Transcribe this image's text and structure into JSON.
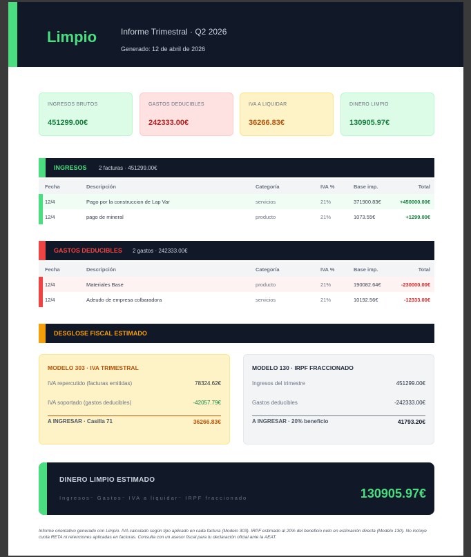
{
  "header": {
    "brand": "Limpio",
    "report_title": "Informe Trimestral · Q2 2026",
    "generated": "Generado: 12 de abril de 2026"
  },
  "kpis": [
    {
      "label": "INGRESOS BRUTOS",
      "value": "451299.00€"
    },
    {
      "label": "GASTOS DEDUCIBLES",
      "value": "242333.00€"
    },
    {
      "label": "IVA A LIQUIDAR",
      "value": "36266.83€"
    },
    {
      "label": "DINERO LIMPIO",
      "value": "130905.97€"
    }
  ],
  "columns": [
    "Fecha",
    "Descripción",
    "Categoría",
    "IVA %",
    "Base imp.",
    "Total"
  ],
  "ingresos": {
    "title": "INGRESOS",
    "summary": "2 facturas · 451299.00€",
    "rows": [
      {
        "fecha": "12/4",
        "desc": "Pago por la construccion de Lap Var",
        "cat": "servicios",
        "iva": "21%",
        "base": "371900.83€",
        "total": "+450000.00€"
      },
      {
        "fecha": "12/4",
        "desc": "pago de mineral",
        "cat": "producto",
        "iva": "21%",
        "base": "1073.55€",
        "total": "+1299.00€"
      }
    ]
  },
  "gastos": {
    "title": "GASTOS DEDUCIBLES",
    "summary": "2 gastos · 242333.00€",
    "rows": [
      {
        "fecha": "12/4",
        "desc": "Materiales Base",
        "cat": "producto",
        "iva": "21%",
        "base": "190082.64€",
        "total": "-230000.00€"
      },
      {
        "fecha": "12/4",
        "desc": "Adeudo de empresa colbaradora",
        "cat": "servicios",
        "iva": "21%",
        "base": "10192.56€",
        "total": "-12333.00€"
      }
    ]
  },
  "desglose": {
    "title": "DESGLOSE FISCAL ESTIMADO",
    "modelo303": {
      "title": "MODELO 303 · IVA TRIMESTRAL",
      "line1_label": "IVA repercutido (facturas emitidas)",
      "line1_value": "78324.62€",
      "line2_label": "IVA soportado (gastos deducibles)",
      "line2_value": "-42057.79€",
      "total_label": "A INGRESAR · Casilla 71",
      "total_value": "36266.83€"
    },
    "modelo130": {
      "title": "MODELO 130 · IRPF FRACCIONADO",
      "line1_label": "Ingresos del trimestre",
      "line1_value": "451299.00€",
      "line2_label": "Gastos deducibles",
      "line2_value": "-242333.00€",
      "total_label": "A INGRESAR · 20% beneficio",
      "total_value": "41793.20€"
    }
  },
  "final": {
    "title": "DINERO LIMPIO ESTIMADO",
    "formula": "Ingresos⁻ Gastos⁻ IVA a liquidar⁻ IRPF fraccionado",
    "amount": "130905.97€"
  },
  "footnote": "Informe orientativo generado con Limpio. IVA calculado según tipo aplicado en cada factura (Modelo 303). IRPF estimado al 20% del beneficio neto en estimación directa (Modelo 130). No incluye cuota RETA ni retenciones aplicadas en facturas. Consulta con un asesor fiscal para tu declaración oficial ante la AEAT.",
  "colors": {
    "accent_green": "#4ade80",
    "accent_red": "#ef4444",
    "accent_orange": "#f59e0b",
    "dark": "#111827"
  }
}
